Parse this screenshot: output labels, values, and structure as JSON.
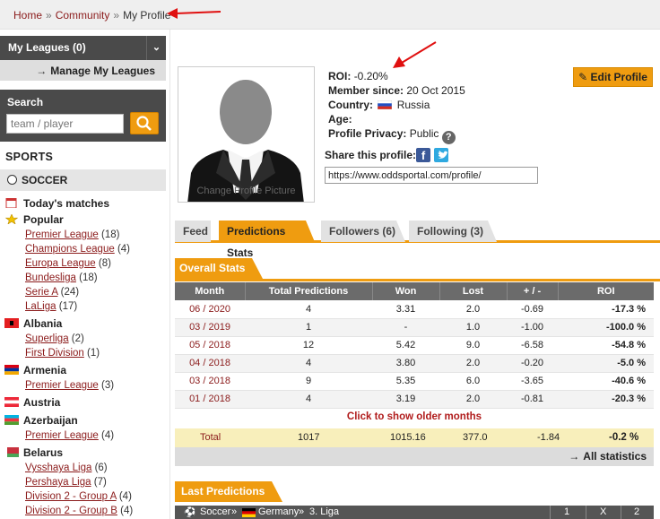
{
  "breadcrumb": {
    "home": "Home",
    "community": "Community",
    "current": "My Profile",
    "sep": "»"
  },
  "sidebar": {
    "my_leagues": "My Leagues (0)",
    "toggle": "⌄",
    "manage": "Manage My Leagues",
    "search_label": "Search",
    "search_placeholder": "team / player",
    "sports_title": "SPORTS",
    "soccer": "SOCCER",
    "todays_matches": "Today's matches",
    "popular": "Popular",
    "popular_items": [
      {
        "name": "Premier League",
        "count": "(18)"
      },
      {
        "name": "Champions League",
        "count": "(4)"
      },
      {
        "name": "Europa League",
        "count": "(8)"
      },
      {
        "name": "Bundesliga",
        "count": "(18)"
      },
      {
        "name": "Serie A",
        "count": "(24)"
      },
      {
        "name": "LaLiga",
        "count": "(17)"
      }
    ],
    "countries": [
      {
        "name": "Albania",
        "items": [
          {
            "name": "Superliga",
            "count": "(2)"
          },
          {
            "name": "First Division",
            "count": "(1)"
          }
        ]
      },
      {
        "name": "Armenia",
        "items": [
          {
            "name": "Premier League",
            "count": "(3)"
          }
        ]
      },
      {
        "name": "Austria",
        "items": []
      },
      {
        "name": "Azerbaijan",
        "items": [
          {
            "name": "Premier League",
            "count": "(4)"
          }
        ]
      },
      {
        "name": "Belarus",
        "items": [
          {
            "name": "Vysshaya Liga",
            "count": "(6)"
          },
          {
            "name": "Pershaya Liga",
            "count": "(7)"
          },
          {
            "name": "Division 2 - Group A",
            "count": "(4)"
          },
          {
            "name": "Division 2 - Group B",
            "count": "(4)"
          }
        ]
      }
    ]
  },
  "profile": {
    "avatar_caption": "Change Profile Picture",
    "roi_label": "ROI:",
    "roi_value": "-0.20%",
    "member_label": "Member since:",
    "member_value": "20 Oct 2015",
    "country_label": "Country:",
    "country_value": "Russia",
    "age_label": "Age:",
    "age_value": "",
    "privacy_label": "Profile Privacy:",
    "privacy_value": "Public",
    "help": "?",
    "edit_button": "Edit Profile",
    "share_label": "Share this profile:",
    "fb": "f",
    "share_url": "https://www.oddsportal.com/profile/"
  },
  "tabs": [
    {
      "label": "Feed"
    },
    {
      "label": "Predictions Stats"
    },
    {
      "label": "Followers (6)"
    },
    {
      "label": "Following (3)"
    }
  ],
  "overall_stats": {
    "title": "Overall Stats",
    "headers": [
      "Month",
      "Total Predictions",
      "Won",
      "Lost",
      "+ / -",
      "ROI"
    ],
    "rows": [
      [
        "06 / 2020",
        "4",
        "3.31",
        "2.0",
        "-0.69",
        "-17.3 %"
      ],
      [
        "03 / 2019",
        "1",
        "-",
        "1.0",
        "-1.00",
        "-100.0 %"
      ],
      [
        "05 / 2018",
        "12",
        "5.42",
        "9.0",
        "-6.58",
        "-54.8 %"
      ],
      [
        "04 / 2018",
        "4",
        "3.80",
        "2.0",
        "-0.20",
        "-5.0 %"
      ],
      [
        "03 / 2018",
        "9",
        "5.35",
        "6.0",
        "-3.65",
        "-40.6 %"
      ],
      [
        "01 / 2018",
        "4",
        "3.19",
        "2.0",
        "-0.81",
        "-20.3 %"
      ]
    ],
    "older": "Click to show older months",
    "total": {
      "label": "Total",
      "predictions": "1017",
      "won": "1015.16",
      "lost": "377.0",
      "pm": "-1.84",
      "roi": "-0.2 %"
    },
    "all_stats": "All statistics"
  },
  "last_predictions": {
    "title": "Last Predictions",
    "sport": "Soccer",
    "country": "Germany",
    "league": "3. Liga",
    "cols": [
      "1",
      "X",
      "2"
    ]
  },
  "colors": {
    "accent": "#ef9c10",
    "link": "#8b1b1b",
    "dark": "#4a4a4a"
  }
}
